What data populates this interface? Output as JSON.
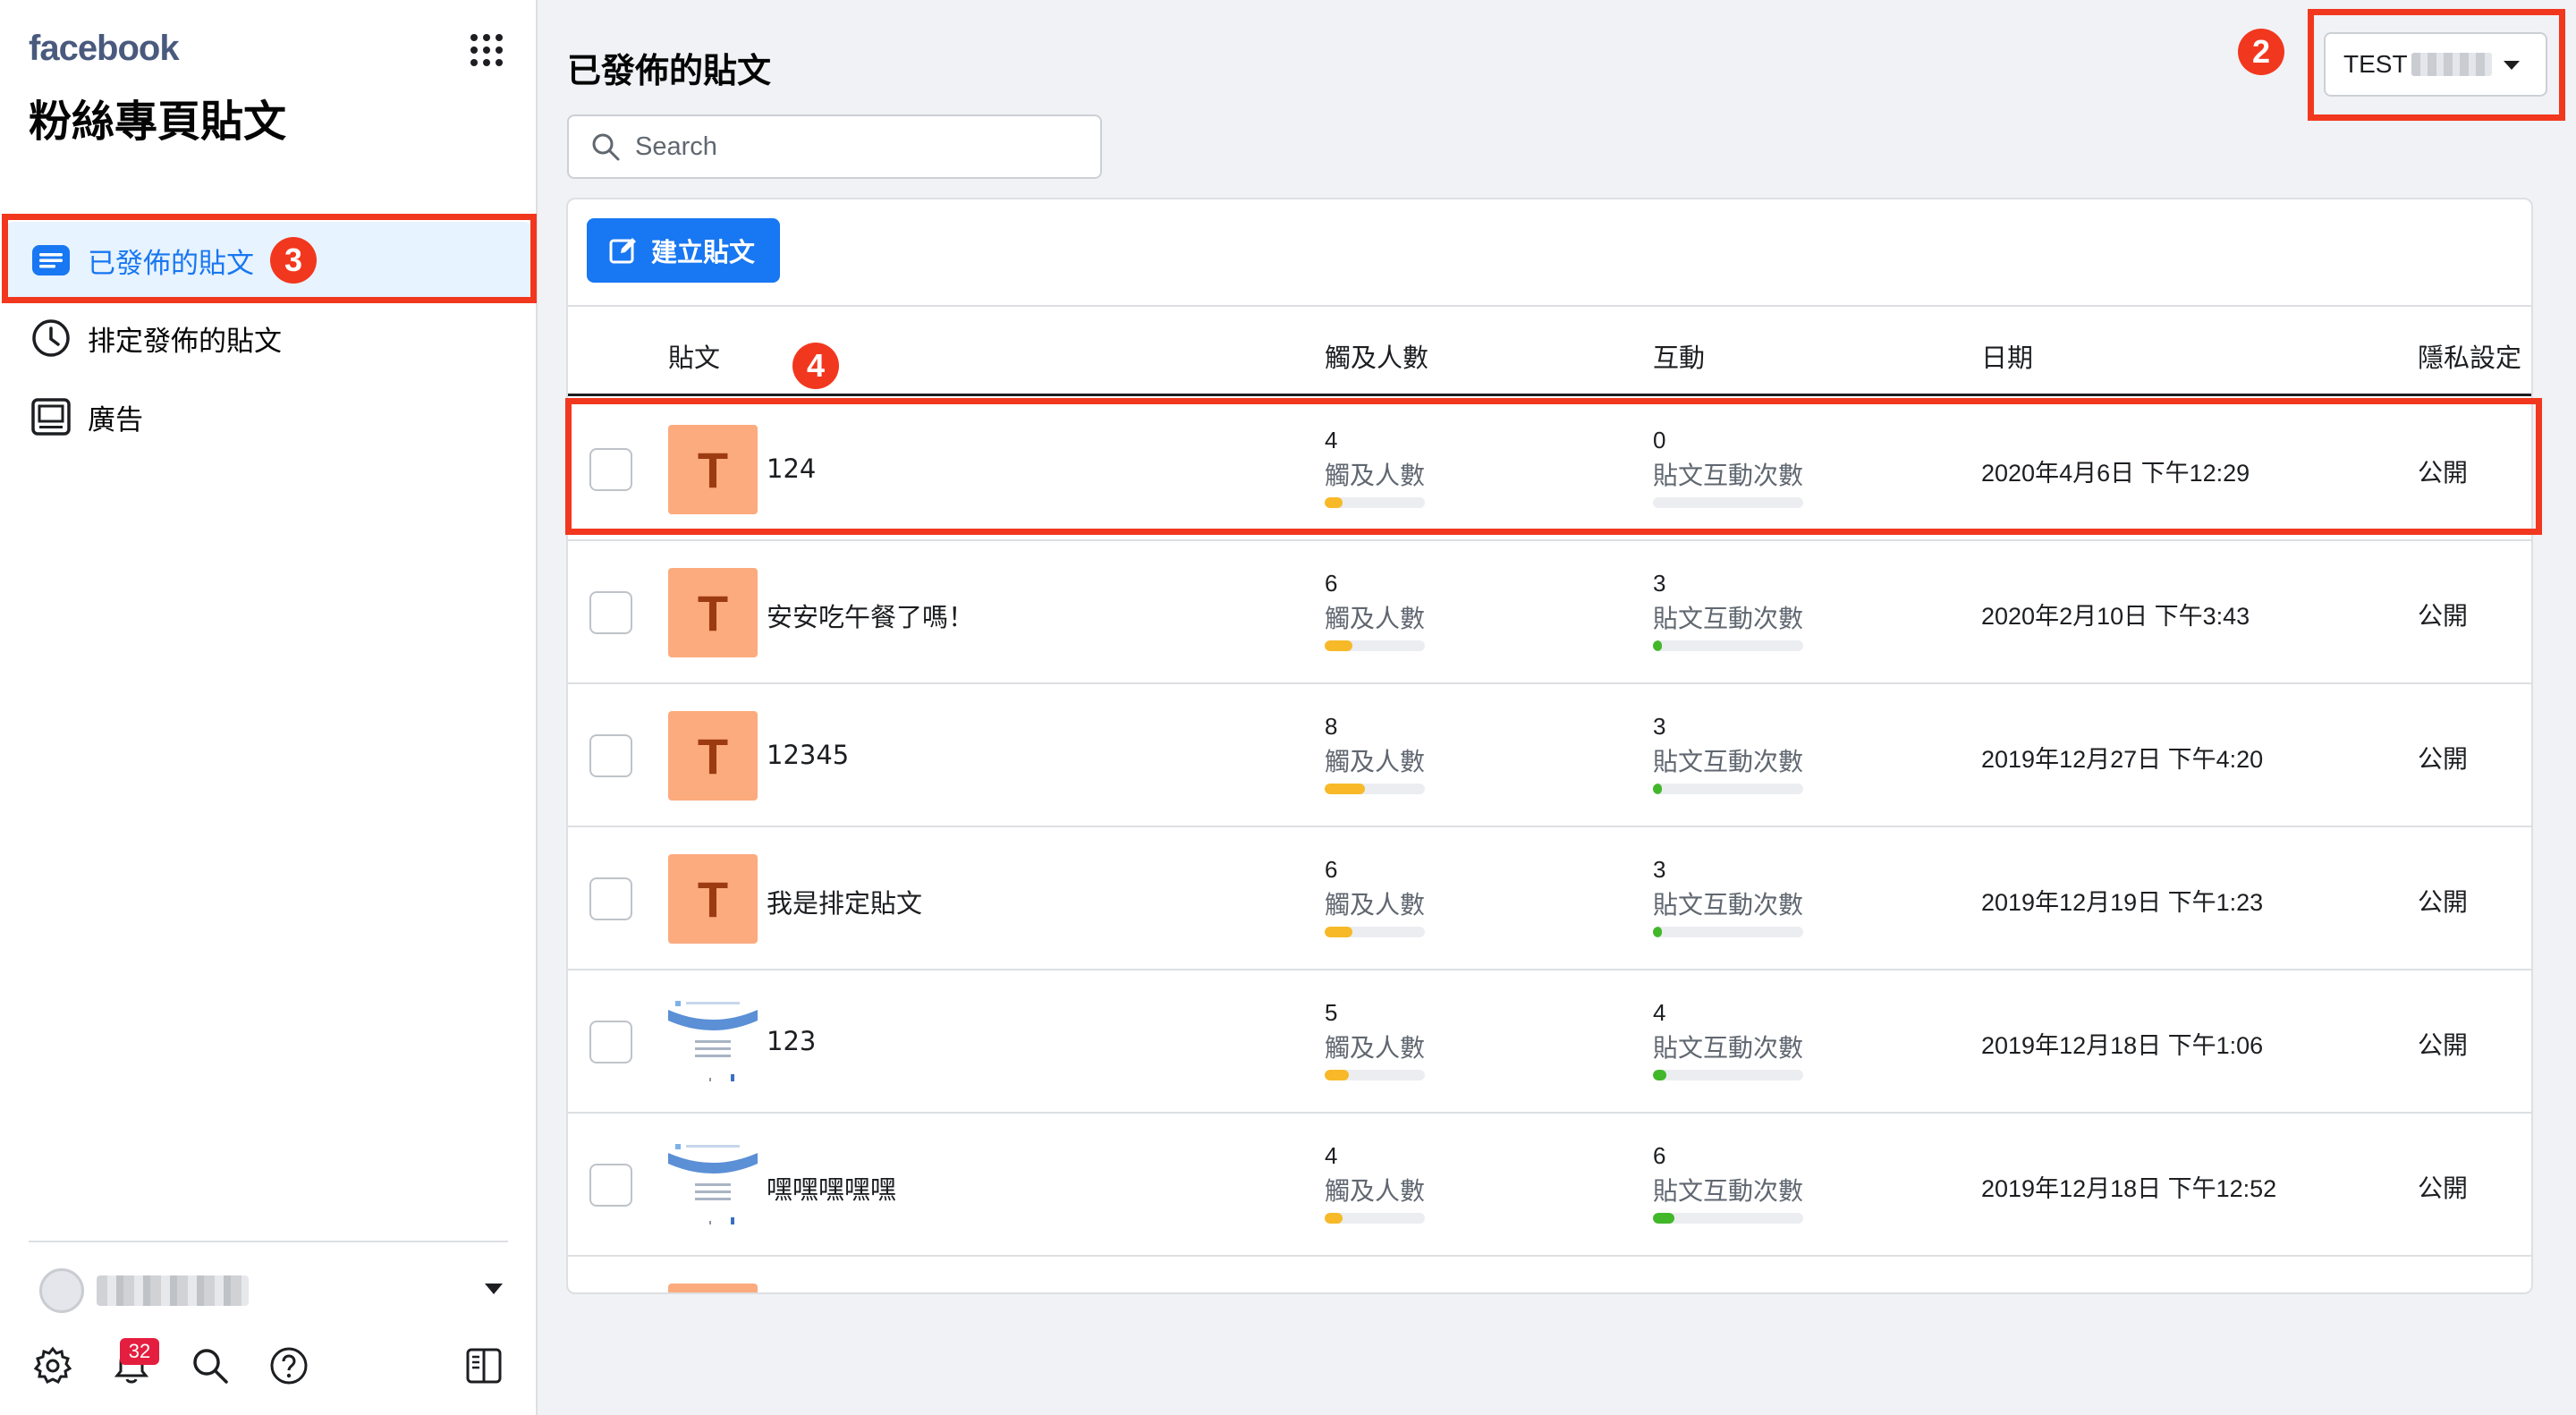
{
  "sidebar": {
    "brand": "facebook",
    "title": "粉絲專頁貼文",
    "nav": [
      {
        "label": "已發佈的貼文",
        "icon": "published-posts-icon",
        "active": true
      },
      {
        "label": "排定發佈的貼文",
        "icon": "clock-icon",
        "active": false
      },
      {
        "label": "廣告",
        "icon": "ads-icon",
        "active": false
      }
    ],
    "notifications_count": "32"
  },
  "annotations": {
    "n2": "2",
    "n3": "3",
    "n4": "4",
    "highlight_color": "#f2371f"
  },
  "main": {
    "title": "已發佈的貼文",
    "search_placeholder": "Search",
    "page_selector": "TEST",
    "create_button": "建立貼文",
    "columns": {
      "post": "貼文",
      "reach": "觸及人數",
      "engagement": "互動",
      "date": "日期",
      "privacy": "隱私設定"
    },
    "rows": [
      {
        "thumb": "T",
        "text": "124",
        "reach": "4",
        "reach_label": "觸及人數",
        "reach_level": 0.18,
        "engagement": "0",
        "engagement_label": "貼文互動次數",
        "engagement_level": 0.0,
        "date": "2020年4月6日 下午12:29",
        "privacy": "公開"
      },
      {
        "thumb": "T",
        "text": "安安吃午餐了嗎！",
        "reach": "6",
        "reach_label": "觸及人數",
        "reach_level": 0.28,
        "engagement": "3",
        "engagement_label": "貼文互動次數",
        "engagement_level": 0.06,
        "date": "2020年2月10日 下午3:43",
        "privacy": "公開"
      },
      {
        "thumb": "T",
        "text": "12345",
        "reach": "8",
        "reach_label": "觸及人數",
        "reach_level": 0.4,
        "engagement": "3",
        "engagement_label": "貼文互動次數",
        "engagement_level": 0.06,
        "date": "2019年12月27日 下午4:20",
        "privacy": "公開"
      },
      {
        "thumb": "T",
        "text": "我是排定貼文",
        "reach": "6",
        "reach_label": "觸及人數",
        "reach_level": 0.28,
        "engagement": "3",
        "engagement_label": "貼文互動次數",
        "engagement_level": 0.06,
        "date": "2019年12月19日 下午1:23",
        "privacy": "公開"
      },
      {
        "thumb": "image",
        "text": "123",
        "reach": "5",
        "reach_label": "觸及人數",
        "reach_level": 0.24,
        "engagement": "4",
        "engagement_label": "貼文互動次數",
        "engagement_level": 0.09,
        "date": "2019年12月18日 下午1:06",
        "privacy": "公開"
      },
      {
        "thumb": "image",
        "text": "嘿嘿嘿嘿嘿",
        "reach": "4",
        "reach_label": "觸及人數",
        "reach_level": 0.18,
        "engagement": "6",
        "engagement_label": "貼文互動次數",
        "engagement_level": 0.14,
        "date": "2019年12月18日 下午12:52",
        "privacy": "公開"
      }
    ]
  },
  "colors": {
    "brand_blue": "#1877f2",
    "reach_bar": "#f7b928",
    "engagement_bar": "#42b72a"
  }
}
